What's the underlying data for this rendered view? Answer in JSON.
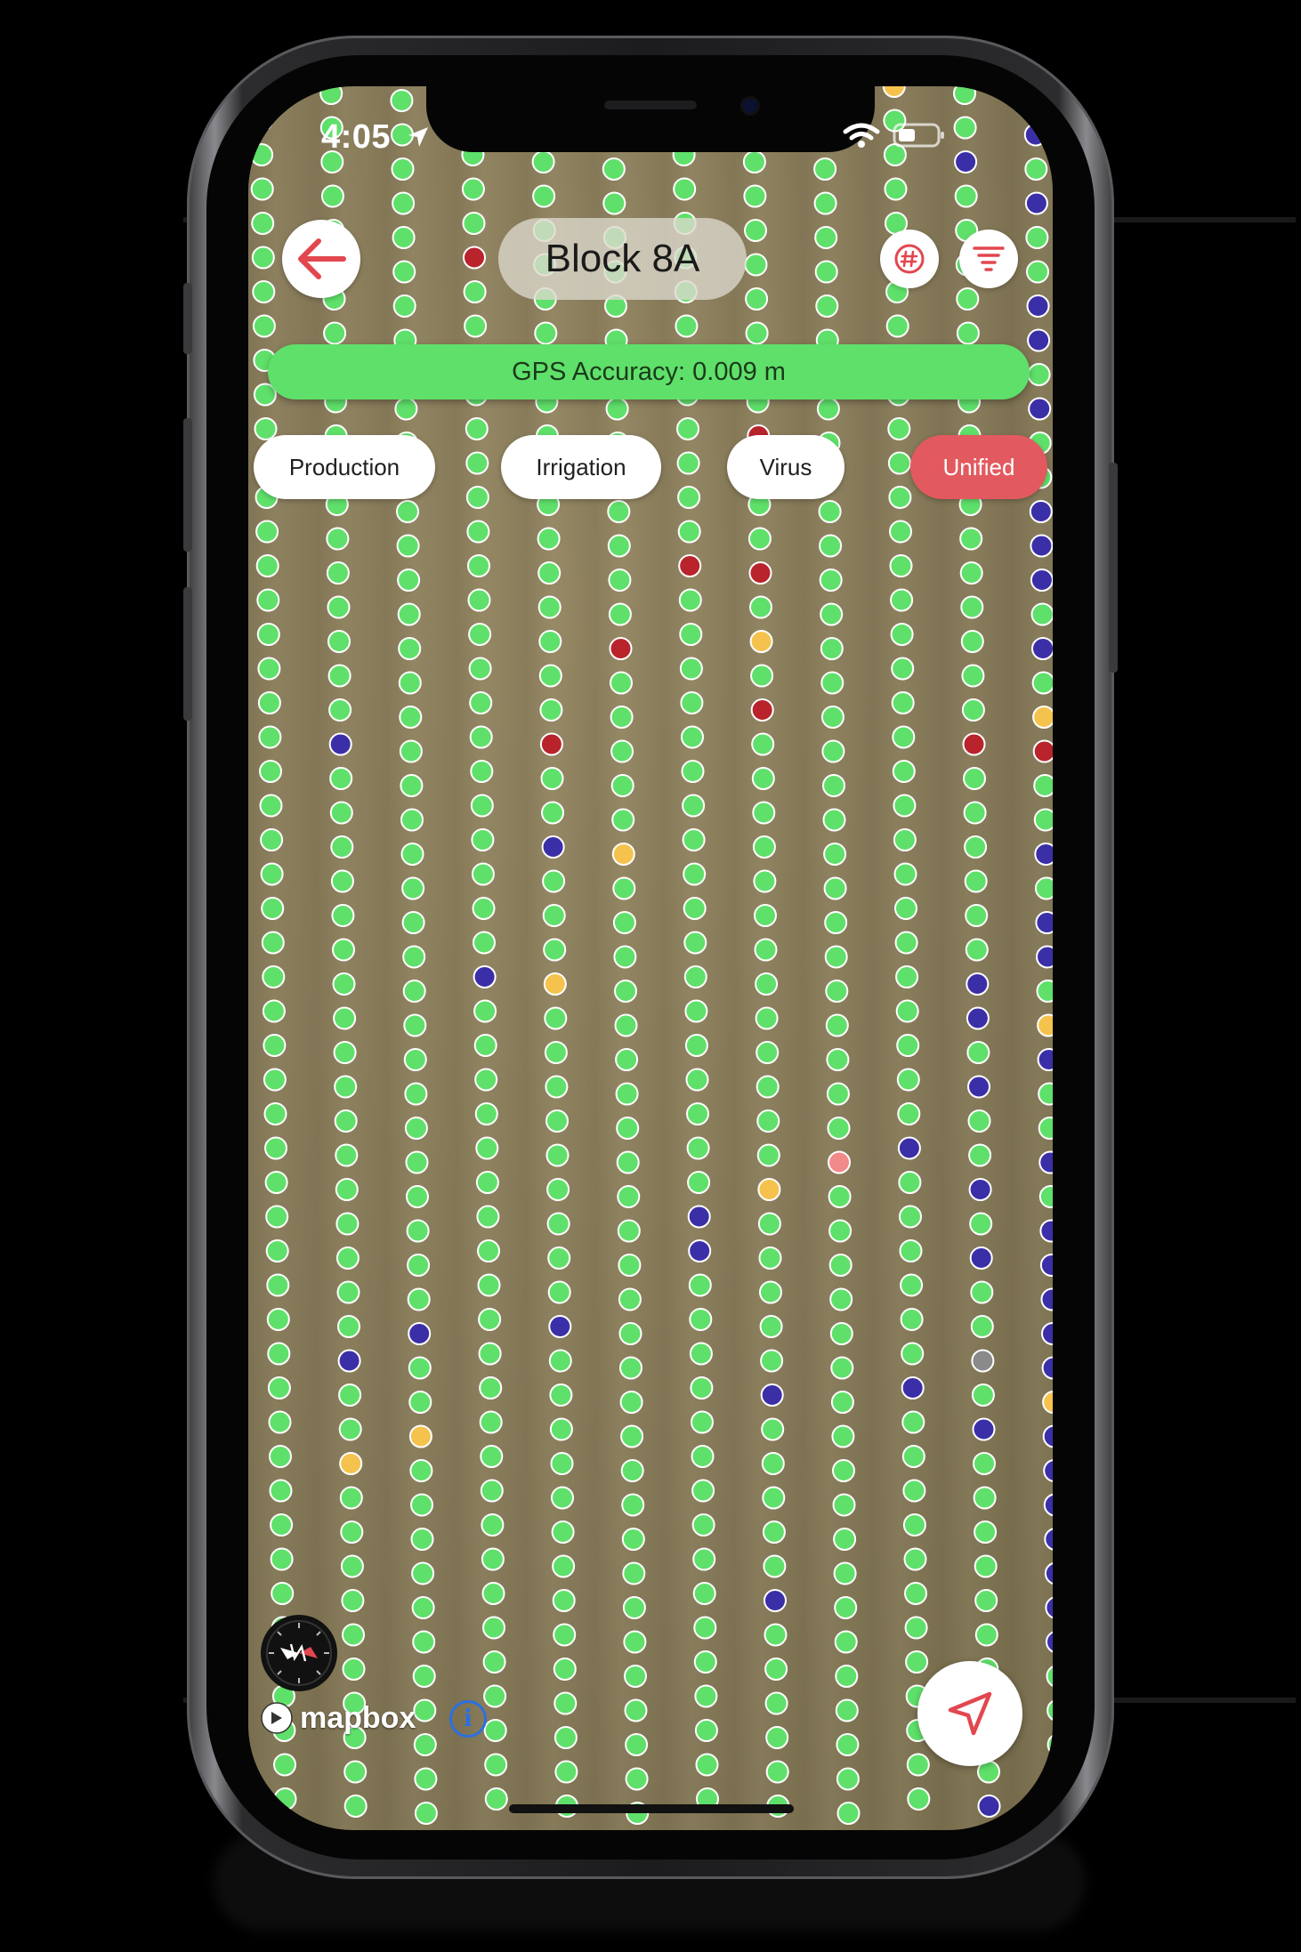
{
  "status_bar": {
    "time": "4:05"
  },
  "header": {
    "title": "Block 8A"
  },
  "gps": {
    "label": "GPS Accuracy: 0.009 m"
  },
  "tabs": [
    {
      "label": "Production",
      "active": false
    },
    {
      "label": "Irrigation",
      "active": false
    },
    {
      "label": "Virus",
      "active": false
    },
    {
      "label": "Unified",
      "active": true
    }
  ],
  "attribution": {
    "brand": "mapbox",
    "info_symbol": "i"
  },
  "icons": {
    "back": "arrow-left-icon",
    "grid_number": "hash-icon",
    "filter": "filter-lines-icon",
    "compass": "compass-icon",
    "locate": "location-arrow-icon"
  },
  "colors": {
    "healthy": "#5fe06a",
    "red": "#b8232c",
    "yellow": "#f5c34d",
    "blue": "#3b2fa8",
    "gray": "#8a8a8a",
    "pink": "#f28a8a",
    "accent": "#e25a5f",
    "gps_bar": "#5fe06a"
  },
  "map": {
    "columns": [
      {
        "special": []
      },
      {
        "special": [
          [
            "blue",
            0.38
          ],
          [
            "blue",
            0.74
          ],
          [
            "yellow",
            0.79
          ]
        ]
      },
      {
        "special": [
          [
            "blue",
            0.72
          ],
          [
            "yellow",
            0.78
          ]
        ]
      },
      {
        "special": [
          [
            "red",
            0.09
          ],
          [
            "blue",
            0.51
          ]
        ]
      },
      {
        "special": [
          [
            "red",
            0.37
          ],
          [
            "blue",
            0.44
          ],
          [
            "yellow",
            0.51
          ],
          [
            "blue",
            0.72
          ]
        ]
      },
      {
        "special": [
          [
            "red",
            0.03
          ],
          [
            "red",
            0.33
          ],
          [
            "yellow",
            0.45
          ]
        ]
      },
      {
        "special": [
          [
            "red",
            0.27
          ],
          [
            "blue",
            0.64
          ],
          [
            "blue",
            0.66
          ]
        ]
      },
      {
        "special": [
          [
            "red",
            0.2
          ],
          [
            "red",
            0.27
          ],
          [
            "yellow",
            0.32
          ],
          [
            "red",
            0.36
          ],
          [
            "yellow",
            0.64
          ],
          [
            "blue",
            0.76
          ],
          [
            "blue",
            0.86
          ]
        ]
      },
      {
        "special": [
          [
            "pink",
            0.61
          ]
        ]
      },
      {
        "special": [
          [
            "yellow",
            0.0
          ],
          [
            "blue",
            0.61
          ],
          [
            "blue",
            0.75
          ]
        ]
      },
      {
        "special": [
          [
            "blue",
            0.04
          ],
          [
            "blue",
            0.16
          ],
          [
            "red",
            0.38
          ],
          [
            "blue",
            0.51
          ],
          [
            "blue",
            0.52
          ],
          [
            "blue",
            0.54
          ],
          [
            "blue",
            0.57
          ],
          [
            "blue",
            0.64
          ],
          [
            "blue",
            0.68
          ],
          [
            "gray",
            0.73
          ],
          [
            "blue",
            0.77
          ],
          [
            "blue",
            0.98
          ]
        ]
      },
      {
        "special": [
          [
            "blue",
            0.0
          ],
          [
            "blue",
            0.02
          ],
          [
            "blue",
            0.06
          ],
          [
            "blue",
            0.12
          ],
          [
            "blue",
            0.14
          ],
          [
            "blue",
            0.18
          ],
          [
            "blue",
            0.25
          ],
          [
            "blue",
            0.27
          ],
          [
            "blue",
            0.29
          ],
          [
            "blue",
            0.33
          ],
          [
            "yellow",
            0.36
          ],
          [
            "gray",
            0.37
          ],
          [
            "red",
            0.39
          ],
          [
            "blue",
            0.45
          ],
          [
            "blue",
            0.47
          ],
          [
            "blue",
            0.49
          ],
          [
            "yellow",
            0.53
          ],
          [
            "blue",
            0.56
          ],
          [
            "blue",
            0.61
          ],
          [
            "blue",
            0.66
          ],
          [
            "blue",
            0.68
          ],
          [
            "blue",
            0.7
          ],
          [
            "blue",
            0.71
          ],
          [
            "blue",
            0.73
          ],
          [
            "yellow",
            0.76
          ],
          [
            "blue",
            0.78
          ],
          [
            "blue",
            0.8
          ],
          [
            "blue",
            0.82
          ],
          [
            "blue",
            0.83
          ],
          [
            "blue",
            0.85
          ],
          [
            "blue",
            0.87
          ],
          [
            "blue",
            0.88
          ],
          [
            "blue",
            0.9
          ]
        ]
      }
    ]
  }
}
